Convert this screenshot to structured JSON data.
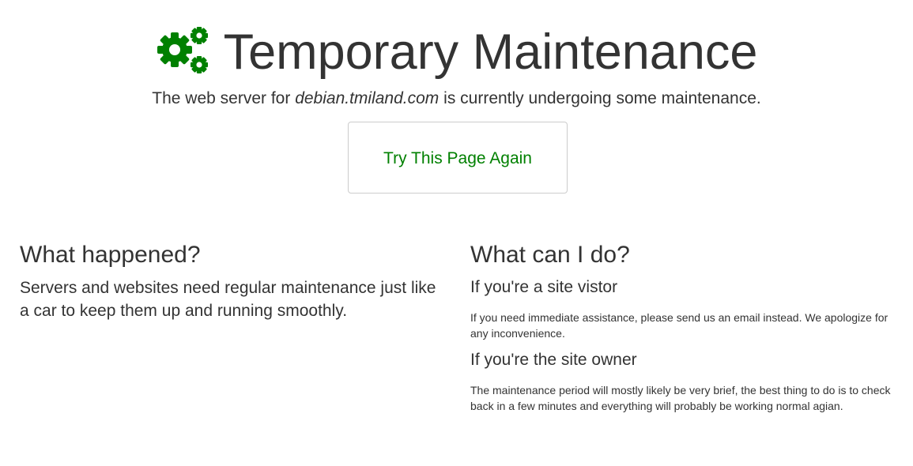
{
  "header": {
    "icon": "gears-icon",
    "icon_color": "#008000",
    "title": "Temporary Maintenance"
  },
  "lead": {
    "prefix": "The web server for",
    "domain": "debian.tmiland.com",
    "suffix": "is currently undergoing some maintenance."
  },
  "retry_button": {
    "label": "Try This Page Again",
    "color": "#008000"
  },
  "what_happened": {
    "heading": "What happened?",
    "text": "Servers and websites need regular maintenance just like a car to keep them up and running smoothly."
  },
  "what_can_i_do": {
    "heading": "What can I do?",
    "visitor": {
      "heading": "If you're a site vistor",
      "text": "If you need immediate assistance, please send us an email instead. We apologize for any inconvenience."
    },
    "owner": {
      "heading": "If you're the site owner",
      "text": "The maintenance period will mostly likely be very brief, the best thing to do is to check back in a few minutes and everything will probably be working normal agian."
    }
  }
}
